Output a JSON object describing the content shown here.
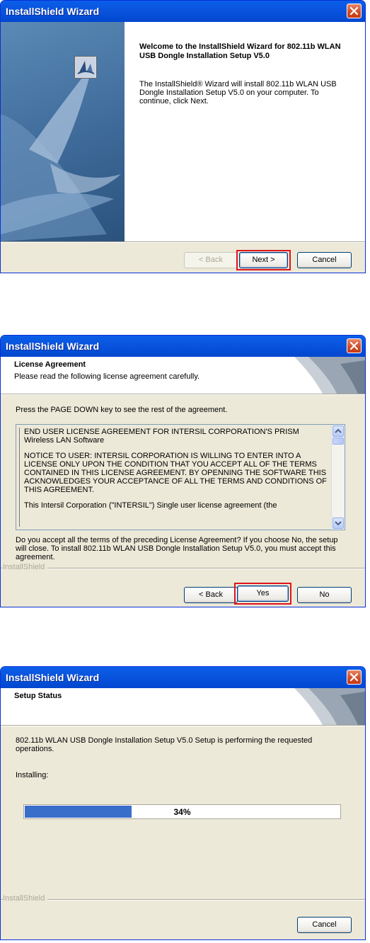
{
  "window1": {
    "title": "InstallShield Wizard",
    "welcome_title": "Welcome to the InstallShield Wizard for 802.11b WLAN USB Dongle Installation Setup V5.0",
    "welcome_text": "The InstallShield® Wizard will install 802.11b WLAN USB Dongle Installation Setup V5.0 on your computer.  To continue, click Next.",
    "back_label": "< Back",
    "next_label": "Next >",
    "cancel_label": "Cancel"
  },
  "window2": {
    "title": "InstallShield Wizard",
    "header_title": "License Agreement",
    "header_subtitle": "Please read the following license agreement carefully.",
    "instruction": "Press the PAGE DOWN key to see the rest of the agreement.",
    "license_paragraphs": [
      "END USER LICENSE AGREEMENT FOR INTERSIL CORPORATION'S PRISM Wireless LAN Software",
      "NOTICE TO USER: INTERSIL CORPORATION IS WILLING TO ENTER INTO A LICENSE ONLY UPON THE CONDITION THAT YOU ACCEPT ALL OF THE TERMS CONTAINED IN THIS LICENSE AGREEMENT. BY OPENNING THE SOFTWARE THIS ACKNOWLEDGES YOUR ACCEPTANCE OF ALL THE TERMS AND CONDITIONS OF THIS AGREEMENT.",
      "This Intersil Corporation (\"INTERSIL\") Single user license agreement (the"
    ],
    "question": "Do you accept all the terms of the preceding License Agreement?  If you choose No,  the setup will close.  To install 802.11b WLAN USB Dongle Installation Setup V5.0, you must accept this agreement.",
    "brand": "InstallShield",
    "back_label": "< Back",
    "yes_label": "Yes",
    "no_label": "No"
  },
  "window3": {
    "title": "InstallShield Wizard",
    "header_title": "Setup Status",
    "status_text": "802.11b WLAN USB Dongle Installation Setup V5.0 Setup is performing the requested operations.",
    "installing_label": "Installing:",
    "progress_percent": 34,
    "progress_label": "34%",
    "brand": "InstallShield",
    "cancel_label": "Cancel"
  },
  "colors": {
    "titlebar": "#0a5ee8",
    "highlight_frame": "#e0141e",
    "progress_fill": "#3a6ecb"
  }
}
